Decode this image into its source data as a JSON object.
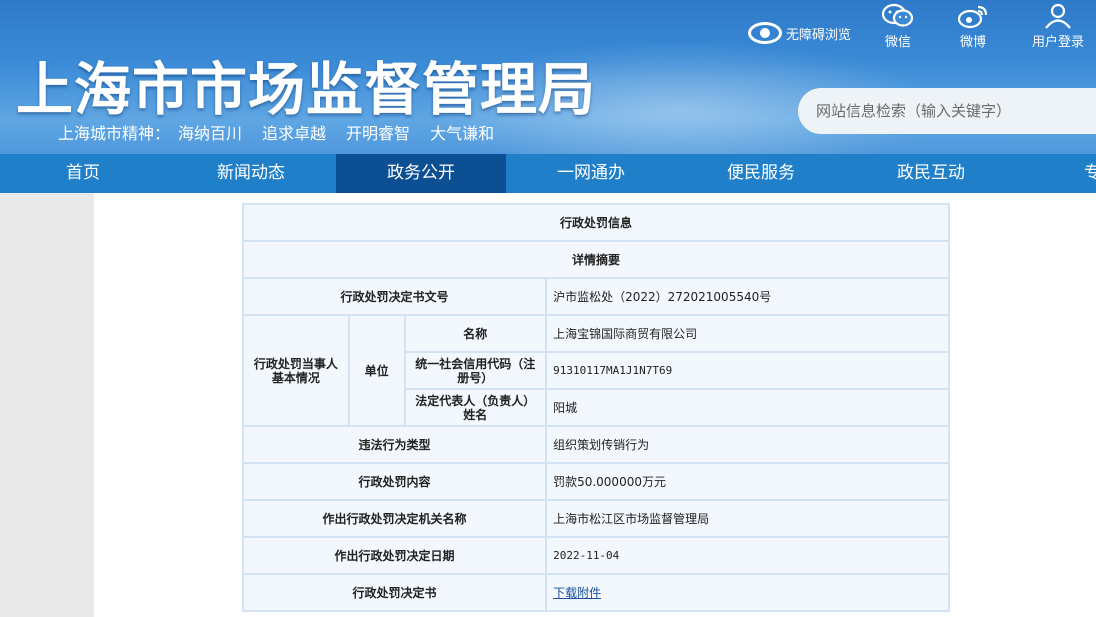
{
  "header": {
    "title": "上海市市场监督管理局",
    "slogan": [
      "上海城市精神：",
      "海纳百川",
      "追求卓越",
      "开明睿智",
      "大气谦和"
    ],
    "accessibility_label": "无障碍浏览",
    "top_links": [
      {
        "label": "微信",
        "icon": "wechat-icon"
      },
      {
        "label": "微博",
        "icon": "weibo-icon"
      },
      {
        "label": "用户登录",
        "icon": "user-icon"
      }
    ],
    "search_placeholder": "网站信息检索（输入关键字）"
  },
  "nav": {
    "items": [
      "首页",
      "新闻动态",
      "政务公开",
      "一网通办",
      "便民服务",
      "政民互动",
      "专题"
    ],
    "active": "政务公开"
  },
  "table": {
    "title": "行政处罚信息",
    "subtitle": "详情摘要",
    "doc_no_label": "行政处罚决定书文号",
    "doc_no_value": "沪市监松处（2022）272021005540号",
    "party_label": "行政处罚当事人基本情况",
    "unit_label": "单位",
    "name_label": "名称",
    "name_value": "上海宝锦国际商贸有限公司",
    "credit_label": "统一社会信用代码（注册号）",
    "credit_value": "91310117MA1J1N7T69",
    "legal_rep_label": "法定代表人（负责人）姓名",
    "legal_rep_value": "阳城",
    "violation_label": "违法行为类型",
    "violation_value": "组织策划传销行为",
    "penalty_label": "行政处罚内容",
    "penalty_value": "罚款50.000000万元",
    "authority_label": "作出行政处罚决定机关名称",
    "authority_value": "上海市松江区市场监督管理局",
    "date_label": "作出行政处罚决定日期",
    "date_value": "2022-11-04",
    "decision_label": "行政处罚决定书",
    "decision_link": "下载附件"
  }
}
